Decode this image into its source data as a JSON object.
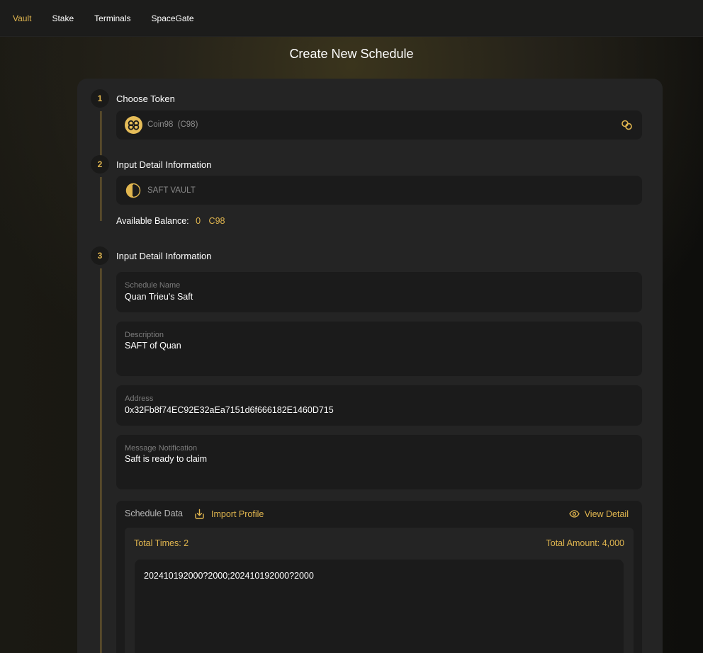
{
  "nav": {
    "items": [
      {
        "label": "Vault",
        "active": true
      },
      {
        "label": "Stake",
        "active": false
      },
      {
        "label": "Terminals",
        "active": false
      },
      {
        "label": "SpaceGate",
        "active": false
      }
    ]
  },
  "page": {
    "title": "Create New Schedule"
  },
  "steps": [
    {
      "number": "1",
      "title": "Choose Token"
    },
    {
      "number": "2",
      "title": "Input Detail Information"
    },
    {
      "number": "3",
      "title": "Input Detail Information"
    }
  ],
  "token": {
    "name": "Coin98",
    "symbol": "(C98)",
    "icon": "coin98-logo-icon"
  },
  "vault": {
    "name": "SAFT VAULT",
    "icon": "saft-vault-logo-icon"
  },
  "balance": {
    "label": "Available Balance:",
    "value": "0",
    "symbol": "C98"
  },
  "form": {
    "schedule_name": {
      "label": "Schedule Name",
      "value": "Quan Trieu's Saft"
    },
    "description": {
      "label": "Description",
      "value": "SAFT of Quan"
    },
    "address": {
      "label": "Address",
      "value": "0x32Fb8f74EC92E32aEa7151d6f666182E1460D715"
    },
    "message": {
      "label": "Message Notification",
      "value": "Saft is ready to claim"
    }
  },
  "schedule_data": {
    "label": "Schedule Data",
    "import_label": "Import Profile",
    "view_label": "View Detail",
    "total_times": "Total Times: 2",
    "total_amount": "Total Amount: 4,000",
    "content": "202410192000?2000;202410192000?2000"
  },
  "colors": {
    "accent": "#e1b64f",
    "card": "#242424",
    "field": "#1b1b1b"
  }
}
